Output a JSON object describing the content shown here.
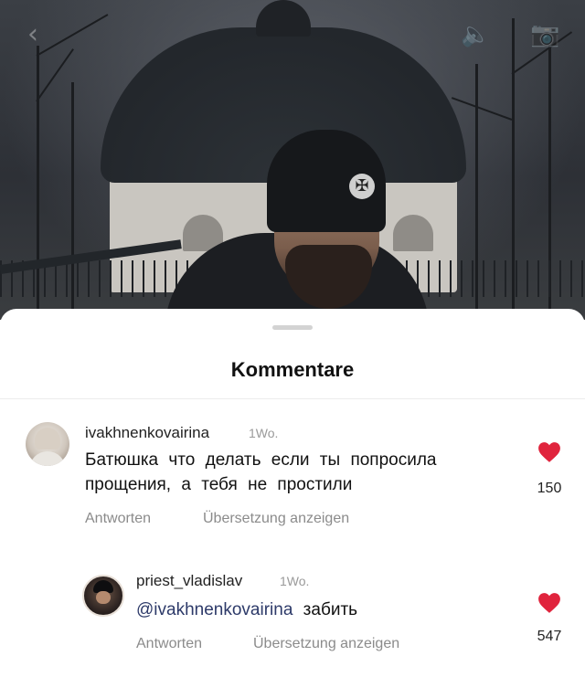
{
  "sheet": {
    "title": "Kommentare"
  },
  "comments": [
    {
      "username": "ivakhnenkovairina",
      "time": "1Wo.",
      "text_line1": "Батюшка что делать если ты попросила",
      "text_line2": "прощения, а тебя не простили",
      "reply_label": "Antworten",
      "translate_label": "Übersetzung anzeigen",
      "likes": "150",
      "liked": true
    },
    {
      "username": "priest_vladislav",
      "time": "1Wo.",
      "mention": "@ivakhnenkovairina",
      "text": "забить",
      "reply_label": "Antworten",
      "translate_label": "Übersetzung anzeigen",
      "likes": "547",
      "liked": true
    }
  ],
  "colors": {
    "heart": "#e0243d",
    "mention": "#2d3a69"
  }
}
